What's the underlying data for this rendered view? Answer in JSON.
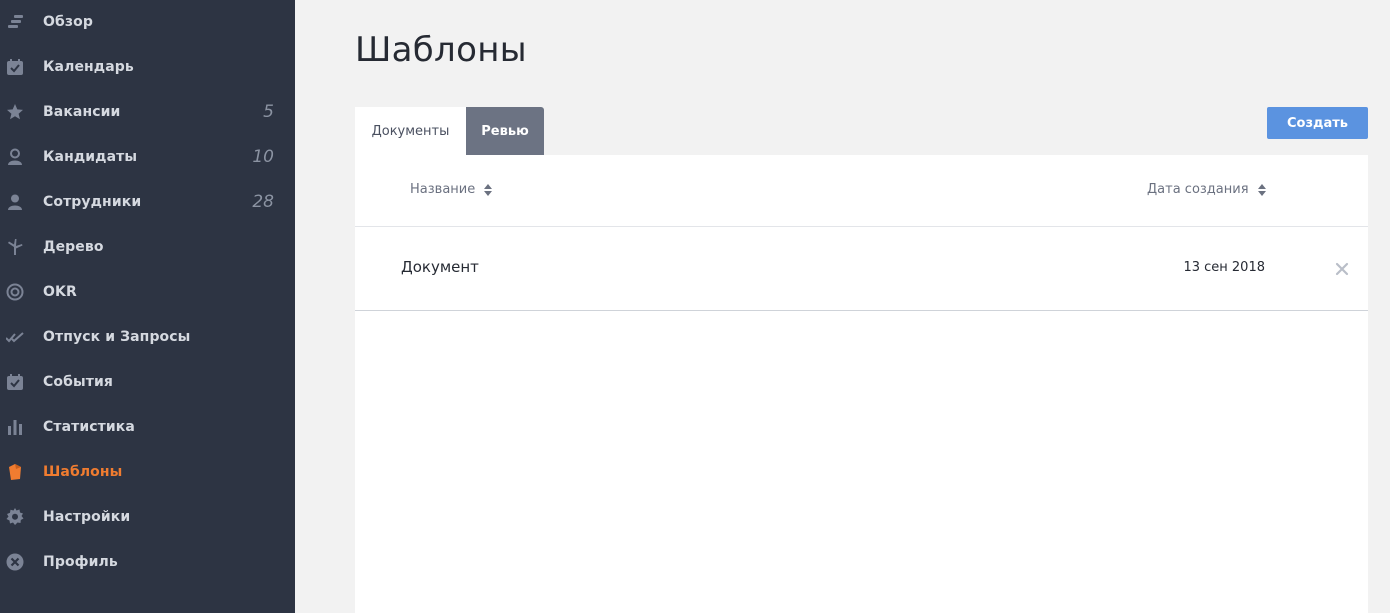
{
  "sidebar": {
    "items": [
      {
        "label": "Обзор",
        "icon": "overview-icon",
        "count": ""
      },
      {
        "label": "Календарь",
        "icon": "calendar-icon",
        "count": ""
      },
      {
        "label": "Вакансии",
        "icon": "star-icon",
        "count": "5"
      },
      {
        "label": "Кандидаты",
        "icon": "person-icon",
        "count": "10"
      },
      {
        "label": "Сотрудники",
        "icon": "people-icon",
        "count": "28"
      },
      {
        "label": "Дерево",
        "icon": "tree-icon",
        "count": ""
      },
      {
        "label": "OKR",
        "icon": "target-icon",
        "count": ""
      },
      {
        "label": "Отпуск и Запросы",
        "icon": "double-check-icon",
        "count": ""
      },
      {
        "label": "События",
        "icon": "event-calendar-icon",
        "count": ""
      },
      {
        "label": "Статистика",
        "icon": "bar-chart-icon",
        "count": ""
      },
      {
        "label": "Шаблоны",
        "icon": "template-icon",
        "count": "",
        "active": true
      },
      {
        "label": "Настройки",
        "icon": "gear-icon",
        "count": ""
      },
      {
        "label": "Профиль",
        "icon": "profile-icon",
        "count": ""
      }
    ]
  },
  "main": {
    "title": "Шаблоны",
    "tabs": [
      {
        "label": "Документы",
        "active": true
      },
      {
        "label": "Ревью",
        "active": false
      }
    ],
    "create_label": "Создать",
    "table": {
      "columns": [
        "Название",
        "Дата создания"
      ],
      "rows": [
        {
          "name": "Документ",
          "date": "13 сен 2018"
        }
      ]
    }
  },
  "colors": {
    "sidebar_bg": "#2d3443",
    "active_accent": "#f07c30",
    "button_blue": "#5b93e0",
    "tab_inactive": "#6c7383"
  }
}
